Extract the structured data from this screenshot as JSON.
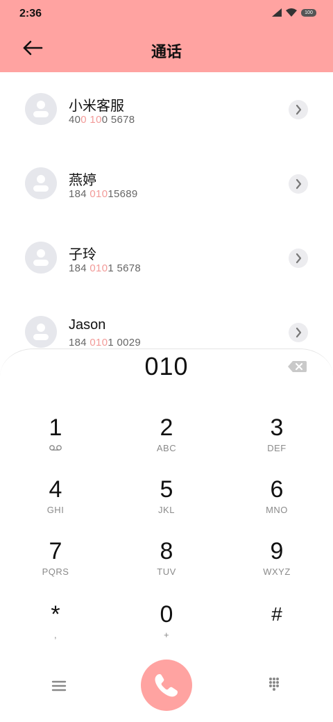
{
  "status": {
    "time": "2:36",
    "battery": "100"
  },
  "header": {
    "title": "通话"
  },
  "contacts": [
    {
      "name": "小米客服",
      "number_parts": [
        "40",
        "0",
        " ",
        "10",
        "0 5678"
      ]
    },
    {
      "name": "燕婷",
      "number_parts": [
        "184 ",
        "010",
        "15689"
      ]
    },
    {
      "name": "子玲",
      "number_parts": [
        "184 ",
        "010",
        "1 5678"
      ]
    },
    {
      "name": "Jason",
      "number_parts": [
        "184 ",
        "010",
        "1 0029"
      ]
    }
  ],
  "dialer": {
    "input": "010",
    "keys": [
      {
        "digit": "1",
        "letters": ""
      },
      {
        "digit": "2",
        "letters": "ABC"
      },
      {
        "digit": "3",
        "letters": "DEF"
      },
      {
        "digit": "4",
        "letters": "GHI"
      },
      {
        "digit": "5",
        "letters": "JKL"
      },
      {
        "digit": "6",
        "letters": "MNO"
      },
      {
        "digit": "7",
        "letters": "PQRS"
      },
      {
        "digit": "8",
        "letters": "TUV"
      },
      {
        "digit": "9",
        "letters": "WXYZ"
      },
      {
        "digit": "*",
        "letters": ","
      },
      {
        "digit": "0",
        "letters": "+"
      },
      {
        "digit": "#",
        "letters": ""
      }
    ]
  },
  "colors": {
    "accent": "#ffa3a1",
    "highlight": "#f29a98"
  }
}
